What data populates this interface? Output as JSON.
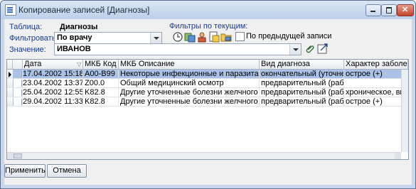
{
  "window": {
    "title": "Копирование записей [Диагнозы]"
  },
  "form": {
    "table_label": "Таблица:",
    "table_value": "Диагнозы",
    "filter_label": "Фильтровать:",
    "filter_value": "По врачу",
    "value_label": "Значение:",
    "value_value": "ИВАНОВ",
    "filters_title": "Фильтры по текущим:",
    "prev_record_label": "По предыдущей записи",
    "prev_record_checked": false
  },
  "toolbar_icons": [
    "clock-icon",
    "copy-filter-icon",
    "person-filter-icon",
    "document-filter-icon",
    "folder-filter-icon"
  ],
  "grid": {
    "columns": [
      "Дата",
      "МКБ Код",
      "МКБ Описание",
      "Вид диагноза",
      "Характер заболевания"
    ],
    "rows": [
      {
        "date": "17.04.2002 15:18",
        "code": "A00-B99",
        "desc": "Некоторые инфекционные и паразитарные болезни",
        "kind": "окончательный (уточненный)",
        "nature": "острое (+)",
        "selected": true
      },
      {
        "date": "23.04.2002 13:37",
        "code": "Z00.0",
        "desc": "Общий медицинский осмотр",
        "kind": "предварительный (рабочий)",
        "nature": "",
        "selected": false
      },
      {
        "date": "25.04.2002 12:55",
        "code": "K82.8",
        "desc": "Другие уточненные болезни желчного пузыря",
        "kind": "предварительный (рабочий)",
        "nature": "хроническое, впервые",
        "selected": false
      },
      {
        "date": "29.04.2002 11:33",
        "code": "K82.8",
        "desc": "Другие уточненные болезни желчного пузыря",
        "kind": "предварительный (рабочий)",
        "nature": "острое (+)",
        "selected": false
      }
    ]
  },
  "buttons": {
    "apply": "Применить",
    "cancel": "Отмена"
  },
  "colors": {
    "selection": "#a9c2e6",
    "label_blue": "#1a3c8c"
  }
}
